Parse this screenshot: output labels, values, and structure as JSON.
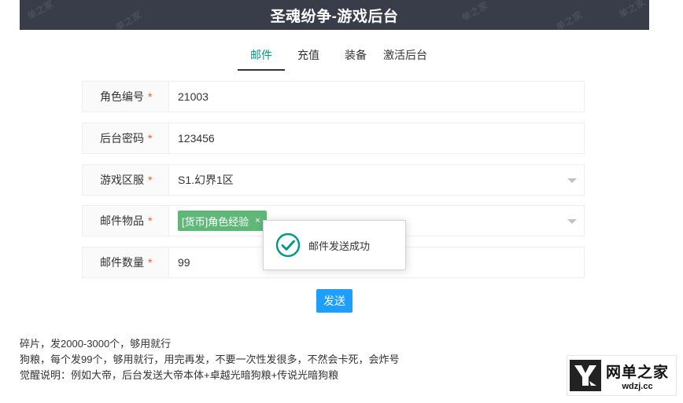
{
  "header": {
    "title": "圣魂纷争-游戏后台",
    "watermark": "单之家"
  },
  "tabs": [
    {
      "label": "邮件",
      "active": true
    },
    {
      "label": "充值",
      "active": false
    },
    {
      "label": "装备",
      "active": false
    },
    {
      "label": "激活后台",
      "active": false
    }
  ],
  "form": {
    "role_id": {
      "label": "角色编号",
      "value": "21003"
    },
    "password": {
      "label": "后台密码",
      "value": "123456"
    },
    "server": {
      "label": "游戏区服",
      "value": "S1.幻界1区"
    },
    "item": {
      "label": "邮件物品",
      "tag": "[货币]角色经验",
      "tag_close": "×"
    },
    "quantity": {
      "label": "邮件数量",
      "value": "99"
    },
    "required_mark": "*"
  },
  "send_button": "发送",
  "toast": {
    "message": "邮件发送成功",
    "icon": "success-check-icon"
  },
  "notes": [
    "碎片，发2000-3000个，够用就行",
    "狗粮，每个发99个，够用就行，用完再发，不要一次性发很多，不然会卡死，会炸号",
    "觉醒说明：例如大帝，后台发送大帝本体+卓越光暗狗粮+传说光暗狗粮"
  ],
  "logo": {
    "cn": "网单之家",
    "en": "wdzj.cc"
  },
  "colors": {
    "header_bg": "#393d49",
    "active_tab": "#009688",
    "required": "#ff5722",
    "tag_bg": "#5fb878",
    "button_bg": "#1e9fff",
    "success_icon": "#009688"
  }
}
